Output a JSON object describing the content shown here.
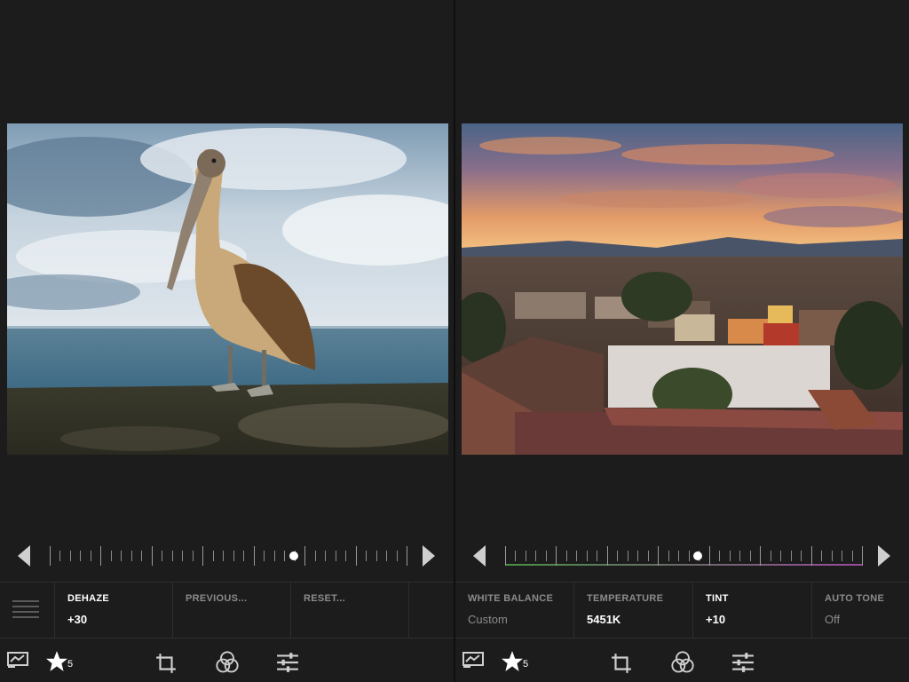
{
  "left": {
    "slider_label": "DEHAZE",
    "slider_value": "+30",
    "slider_position": 0.685,
    "cells": [
      {
        "label": "DEHAZE",
        "value": "+30",
        "active": true
      },
      {
        "label": "PREVIOUS...",
        "value": "",
        "active": false
      },
      {
        "label": "RESET...",
        "value": "",
        "active": false
      }
    ],
    "star_count": "5",
    "photo_desc": "pelican-photo"
  },
  "right": {
    "slider_position": 0.54,
    "cells": [
      {
        "label": "WHITE BALANCE",
        "value": "Custom",
        "active": false
      },
      {
        "label": "TEMPERATURE",
        "value": "5451K",
        "active": false
      },
      {
        "label": "TINT",
        "value": "+10",
        "active": true
      },
      {
        "label": "AUTO TONE",
        "value": "Off",
        "active": false
      }
    ],
    "star_count": "5"
  },
  "colors": {
    "background": "#1c1c1c",
    "panel_border": "#2e2e2e",
    "active_text": "#ffffff",
    "inactive_text": "#8b8b8b"
  },
  "icons": [
    "flag-icon",
    "star-icon",
    "crop-icon",
    "color-mix-icon",
    "sliders-icon",
    "menu-icon",
    "arrow-left-icon",
    "arrow-right-icon"
  ]
}
